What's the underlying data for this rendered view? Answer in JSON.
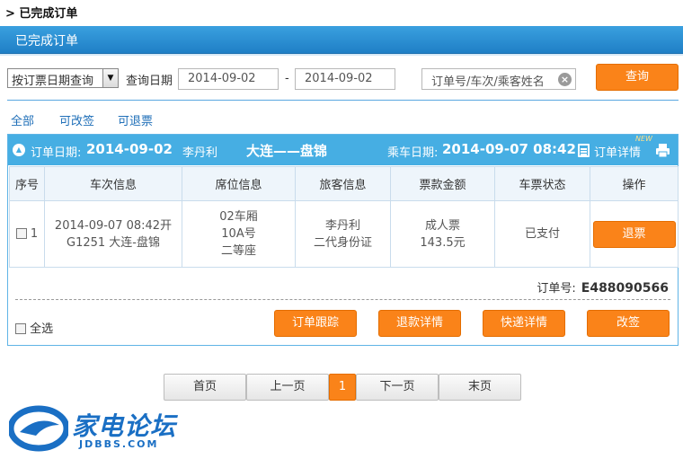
{
  "breadcrumb": "> 已完成订单",
  "section_title": "已完成订单",
  "search": {
    "query_type": "按订票日期查询",
    "date_label": "查询日期",
    "date_from": "2014-09-02",
    "date_sep": "-",
    "date_to": "2014-09-02",
    "keyword_placeholder": "订单号/车次/乘客姓名",
    "query_button": "查询"
  },
  "filters": [
    "全部",
    "可改签",
    "可退票"
  ],
  "order": {
    "order_date_label": "订单日期:",
    "order_date": "2014-09-02",
    "passenger": "李丹利",
    "route": "大连——盘锦",
    "ride_date_label": "乘车日期:",
    "ride_datetime": "2014-09-07 08:42",
    "detail_link": "订单详情",
    "new_badge": "NEW",
    "columns": [
      "序号",
      "车次信息",
      "席位信息",
      "旅客信息",
      "票款金额",
      "车票状态",
      "操作"
    ],
    "row": {
      "index": "1",
      "train_line1": "2014-09-07 08:42开",
      "train_line2": "G1251 大连-盘锦",
      "seat_line1": "02车厢",
      "seat_line2": "10A号",
      "seat_line3": "二等座",
      "traveler_name": "李丹利",
      "traveler_id": "二代身份证",
      "fare_type": "成人票",
      "fare_amount": "143.5元",
      "status": "已支付",
      "action": "退票"
    },
    "order_no_label": "订单号:",
    "order_no": "E488090566",
    "select_all": "全选",
    "actions": [
      "订单跟踪",
      "退款详情",
      "快递详情",
      "改签"
    ]
  },
  "pagination": {
    "first": "首页",
    "prev": "上一页",
    "current": "1",
    "next": "下一页",
    "last": "末页"
  },
  "watermark": {
    "name": "家电论坛",
    "url": "JDBBS.COM"
  },
  "colors": {
    "accent_orange": "#fa8319",
    "header_blue": "#46aee3",
    "bar_blue": "#1f7fc6",
    "link_blue": "#1f6fb8"
  }
}
